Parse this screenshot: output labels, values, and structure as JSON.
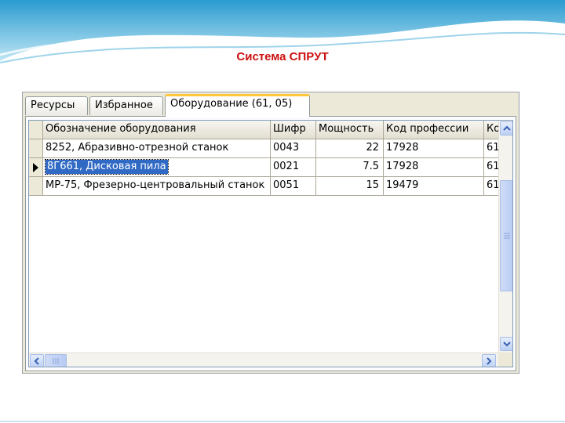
{
  "slide": {
    "title": "Система СПРУТ"
  },
  "tabs": [
    {
      "label": "Ресурсы",
      "active": false
    },
    {
      "label": "Избранное",
      "active": false
    },
    {
      "label": "Оборудование (61, 05)",
      "active": true
    }
  ],
  "table": {
    "columns": [
      "Обозначение оборудования",
      "Шифр",
      "Мощность",
      "Код профессии",
      "Ко"
    ],
    "rows": [
      {
        "name": "8252, Абразивно-отрезной станок",
        "code": "0043",
        "power": "22",
        "profession_code": "17928",
        "extra": "61"
      },
      {
        "name": "8Г661, Дисковая пила",
        "code": "0021",
        "power": "7.5",
        "profession_code": "17928",
        "extra": "61"
      },
      {
        "name": "МР-75, Фрезерно-центровальный станок",
        "code": "0051",
        "power": "15",
        "profession_code": "19479",
        "extra": "61"
      }
    ],
    "selected_row": 1
  },
  "icons": {
    "scroll_up": "chevron-up-icon",
    "scroll_down": "chevron-down-icon",
    "scroll_left": "chevron-left-icon",
    "scroll_right": "chevron-right-icon",
    "row_indicator": "triangle-right-icon"
  },
  "colors": {
    "title": "#cc1111",
    "selection": "#316ac5",
    "active_tab_accent": "#ffc83c"
  }
}
